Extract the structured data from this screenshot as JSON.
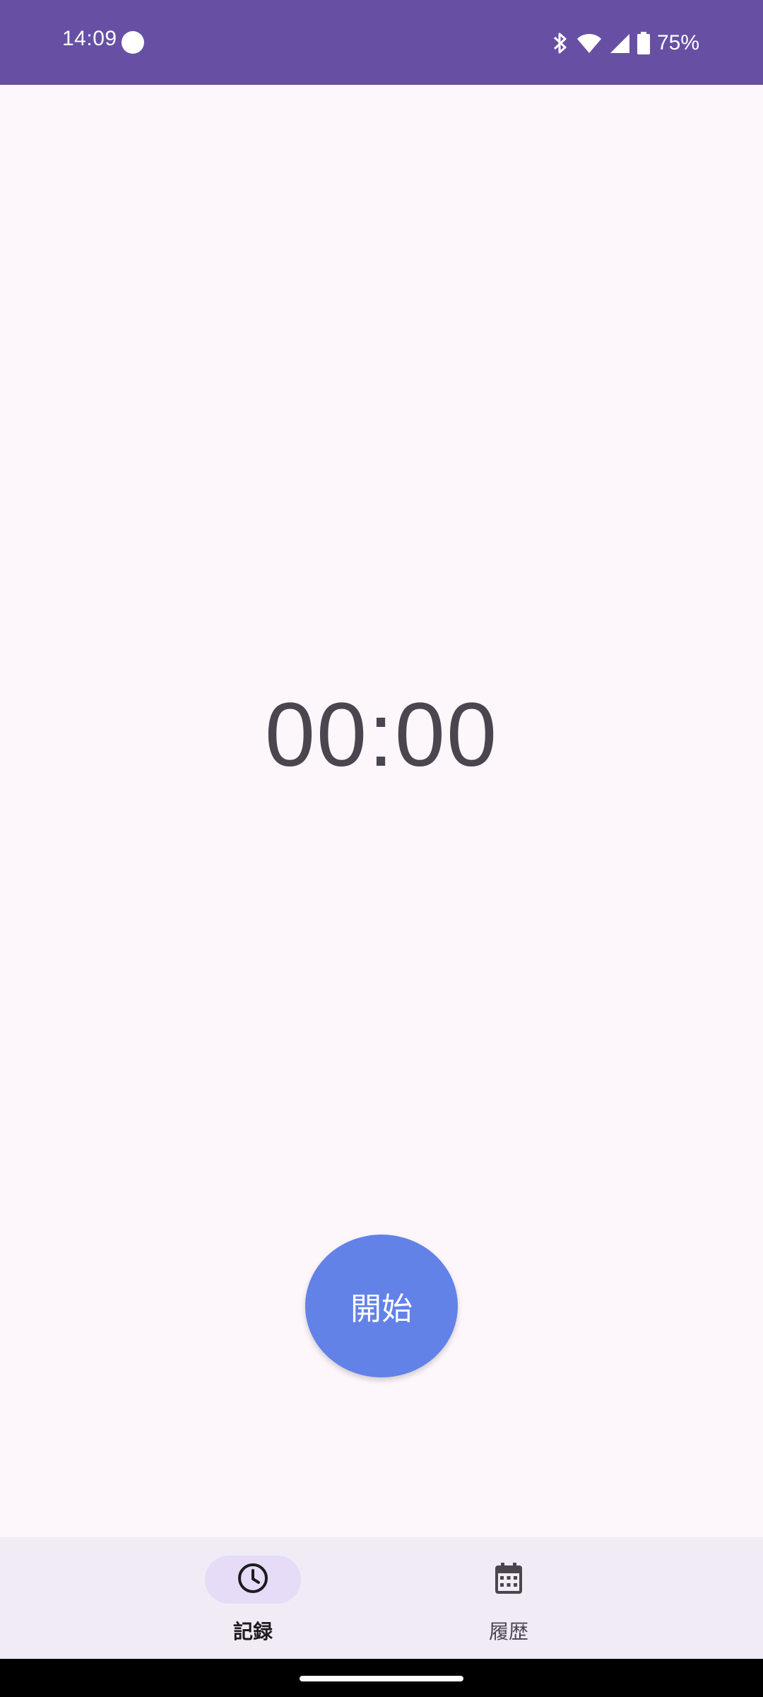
{
  "status_bar": {
    "time": "14:09",
    "battery_percent": "75%",
    "background_color": "#6750a4",
    "icons": [
      "record-dot-icon",
      "bluetooth-icon",
      "wifi-icon",
      "cell-signal-icon",
      "battery-icon"
    ]
  },
  "timer": {
    "display": "00:00"
  },
  "start_button": {
    "label": "開始",
    "color": "#6282e8"
  },
  "bottom_nav": {
    "items": [
      {
        "label": "記録",
        "icon": "clock-icon",
        "selected": true
      },
      {
        "label": "履歴",
        "icon": "calendar-icon",
        "selected": false
      }
    ],
    "selected_pill_color": "#e6dcf7"
  }
}
